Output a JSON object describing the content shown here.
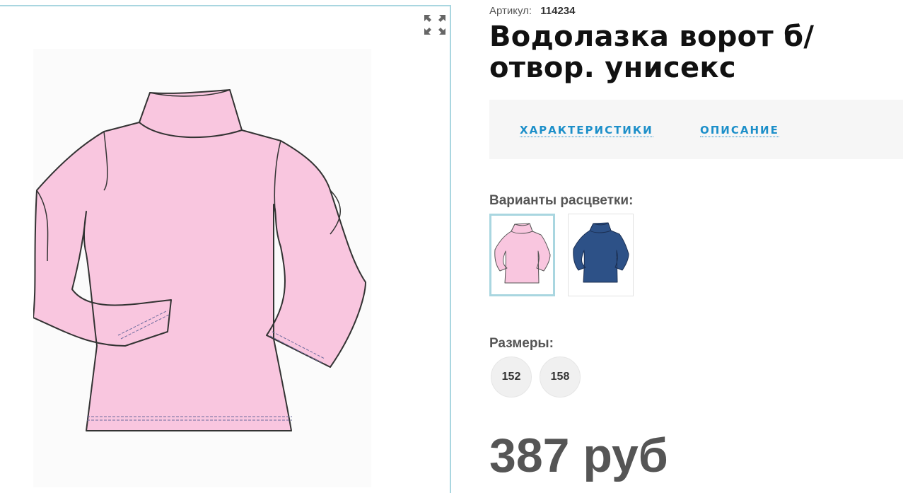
{
  "product": {
    "sku_label": "Артикул:",
    "sku_value": "114234",
    "title": "Водолазка ворот б/отвор. унисекс",
    "tabs": [
      {
        "label": "ХАРАКТЕРИСТИКИ"
      },
      {
        "label": "ОПИСАНИЕ"
      }
    ],
    "colors_label": "Варианты расцветки:",
    "colors": [
      {
        "hex": "#f9c6df",
        "selected": true
      },
      {
        "hex": "#2d5187",
        "selected": false
      }
    ],
    "sizes_label": "Размеры:",
    "sizes": [
      "152",
      "158"
    ],
    "price": "387 руб"
  },
  "icons": {
    "fullscreen": "expand-icon"
  },
  "colors": {
    "accent": "#1c8fc9",
    "border_highlight": "#a9d6e0",
    "shirt_pink": "#f9c6df",
    "shirt_navy": "#2d5187"
  }
}
